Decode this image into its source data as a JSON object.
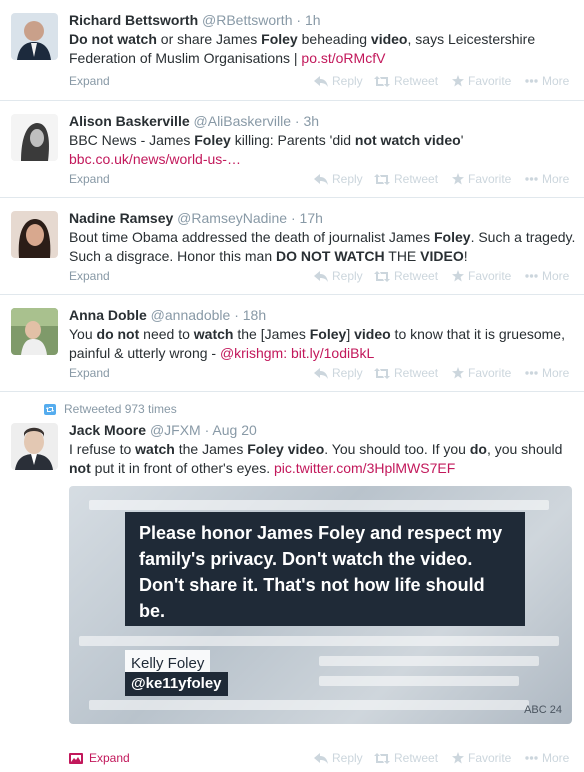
{
  "colors": {
    "link": "#c2185b",
    "muted": "#8899a6",
    "faint": "#ccd6dd"
  },
  "actions": {
    "reply": "Reply",
    "retweet": "Retweet",
    "favorite": "Favorite",
    "more": "More"
  },
  "tweets": [
    {
      "fullname": "Richard Bettsworth",
      "handle": "@RBettsworth",
      "sep": "·",
      "time": "1h",
      "t": [
        "",
        "Do not watch",
        " or share James ",
        "Foley",
        " beheading ",
        "video",
        ", says Leicestershire Federation of Muslim Organisations | "
      ],
      "link": "po.st/oRMcfV",
      "expand": "Expand"
    },
    {
      "fullname": "Alison Baskerville",
      "handle": "@AliBaskerville",
      "sep": "·",
      "time": "3h",
      "t": [
        "BBC News - James ",
        "Foley",
        " killing: Parents 'did ",
        "not watch video",
        "' "
      ],
      "link": "bbc.co.uk/news/world-us-…",
      "expand": "Expand"
    },
    {
      "fullname": "Nadine Ramsey",
      "handle": "@RamseyNadine",
      "sep": "·",
      "time": "17h",
      "t": [
        "Bout time Obama addressed the death of journalist James ",
        "Foley",
        ". Such a tragedy. Such a disgrace. Honor this man ",
        "DO NOT WATCH",
        " THE ",
        "VIDEO",
        "!"
      ],
      "expand": "Expand"
    },
    {
      "fullname": "Anna Doble",
      "handle": "@annadoble",
      "sep": "·",
      "time": "18h",
      "t": [
        "You ",
        "do not",
        " need to ",
        "watch",
        " the [James ",
        "Foley",
        "] ",
        "video",
        " to know that it is gruesome, painful & utterly wrong - "
      ],
      "link": "@krishgm: bit.ly/1odiBkL",
      "expand": "Expand"
    },
    {
      "retweeted": "Retweeted 973 times",
      "fullname": "Jack Moore",
      "handle": "@JFXM",
      "sep": "·",
      "time": "Aug 20",
      "t": [
        "I refuse to ",
        "watch",
        " the James ",
        "Foley",
        " ",
        "video",
        ". You should too. If you ",
        "do",
        ", you should ",
        "not",
        " put it in front of other's eyes. "
      ],
      "link": "pic.twitter.com/3HplMWS7EF",
      "expand": "Expand",
      "media": {
        "caption": "Please honor James Foley and respect my family's privacy. Don't watch the video. Don't share it. That's not how life should be.",
        "name": "Kelly Foley",
        "handle": "@ke11yfoley",
        "logo": "ABC 24"
      }
    }
  ]
}
